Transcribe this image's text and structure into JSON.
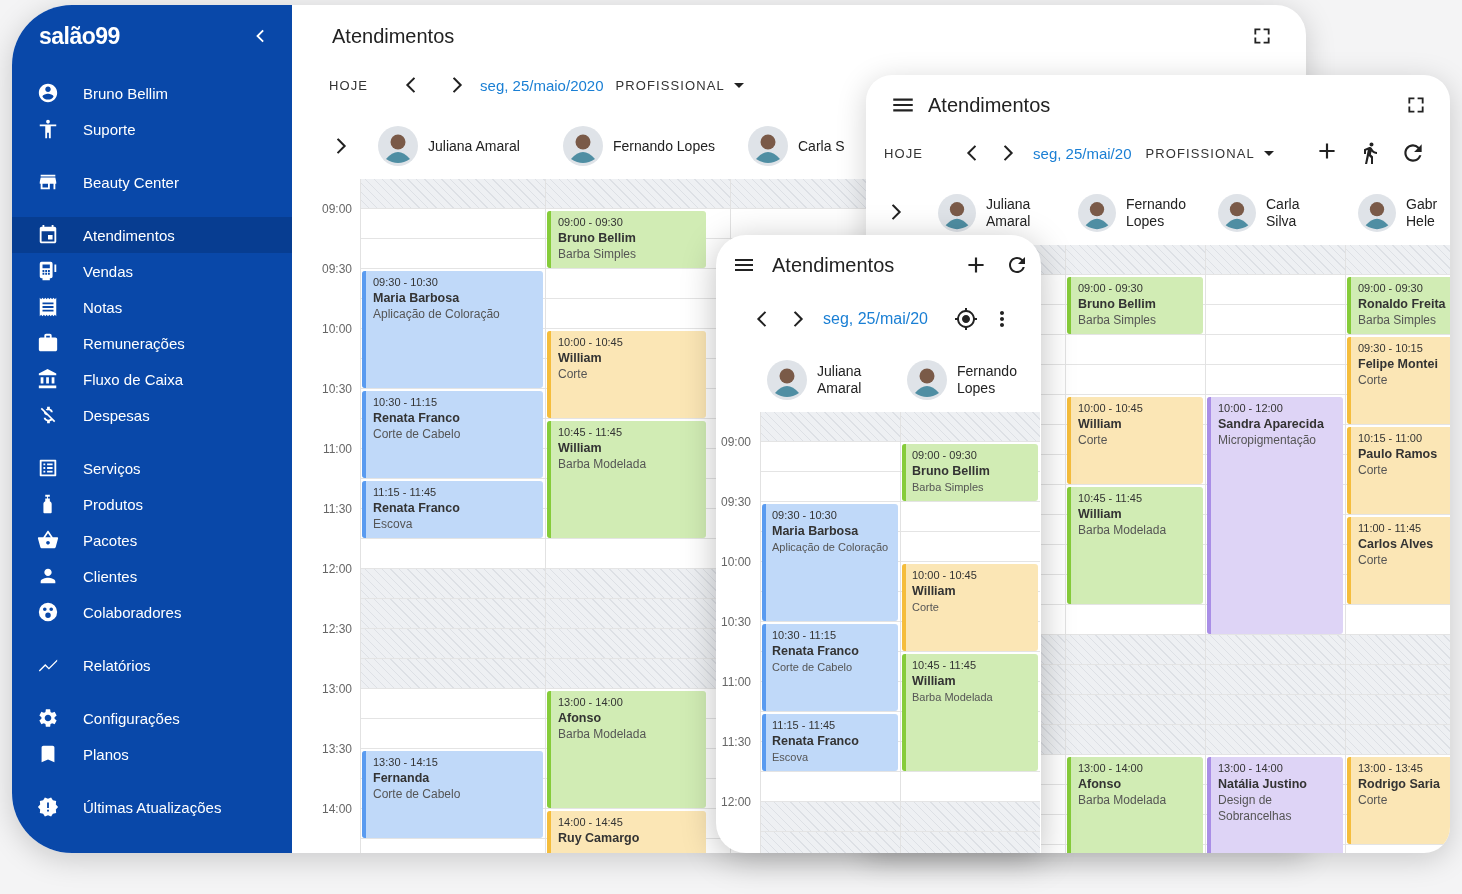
{
  "desktop": {
    "sidebar": {
      "logo": "salão99",
      "groups": [
        {
          "items": [
            {
              "label": "Bruno Bellim",
              "selected": false
            },
            {
              "label": "Suporte",
              "selected": false
            }
          ]
        },
        {
          "items": [
            {
              "label": "Beauty Center",
              "selected": false
            }
          ]
        },
        {
          "items": [
            {
              "label": "Atendimentos",
              "selected": true
            },
            {
              "label": "Vendas",
              "selected": false
            },
            {
              "label": "Notas",
              "selected": false
            },
            {
              "label": "Remunerações",
              "selected": false
            },
            {
              "label": "Fluxo de Caixa",
              "selected": false
            },
            {
              "label": "Despesas",
              "selected": false
            }
          ]
        },
        {
          "items": [
            {
              "label": "Serviços",
              "selected": false
            },
            {
              "label": "Produtos",
              "selected": false
            },
            {
              "label": "Pacotes",
              "selected": false
            },
            {
              "label": "Clientes",
              "selected": false
            },
            {
              "label": "Colaboradores",
              "selected": false
            }
          ]
        },
        {
          "items": [
            {
              "label": "Relatórios",
              "selected": false
            }
          ]
        },
        {
          "items": [
            {
              "label": "Configurações",
              "selected": false
            },
            {
              "label": "Planos",
              "selected": false
            }
          ]
        },
        {
          "items": [
            {
              "label": "Últimas Atualizações",
              "selected": false
            }
          ]
        }
      ]
    },
    "title": "Atendimentos",
    "toolbar": {
      "today": "HOJE",
      "date": "seg, 25/maio/2020",
      "filter": "PROFISSIONAL"
    },
    "professionals": [
      {
        "name": "Juliana Amaral"
      },
      {
        "name": "Fernando Lopes"
      },
      {
        "name": "Carla S"
      }
    ],
    "calendar": {
      "top_closed": true,
      "slots": [
        {
          "time": "09:00",
          "closed": false
        },
        {
          "time": "09:30",
          "closed": false
        },
        {
          "time": "10:00",
          "closed": false
        },
        {
          "time": "10:30",
          "closed": false
        },
        {
          "time": "11:00",
          "closed": false
        },
        {
          "time": "11:30",
          "closed": false
        },
        {
          "time": "12:00",
          "closed": true
        },
        {
          "time": "12:30",
          "closed": true
        },
        {
          "time": "13:00",
          "closed": false
        },
        {
          "time": "13:30",
          "closed": false
        },
        {
          "time": "14:00",
          "closed": false
        }
      ],
      "columns": [
        {
          "events": [
            {
              "time": "09:30 - 10:30",
              "client": "Maria Barbosa",
              "service": "Aplicação de Coloração",
              "color": "#5a9bf0"
            },
            {
              "time": "10:30 - 11:15",
              "client": "Renata Franco",
              "service": "Corte de Cabelo",
              "color": "#5a9bf0"
            },
            {
              "time": "11:15 - 11:45",
              "client": "Renata Franco",
              "service": "Escova",
              "color": "#5a9bf0"
            },
            {
              "time": "13:30 - 14:15",
              "client": "Fernanda",
              "service": "Corte de Cabelo",
              "color": "#5a9bf0"
            }
          ]
        },
        {
          "events": [
            {
              "time": "09:00 - 09:30",
              "client": "Bruno Bellim",
              "service": "Barba Simples",
              "color": "#86cc3a"
            },
            {
              "time": "10:00 - 10:45",
              "client": "William",
              "service": "Corte",
              "color": "#f5bd3c"
            },
            {
              "time": "10:45 - 11:45",
              "client": "William",
              "service": "Barba Modelada",
              "color": "#86cc3a"
            },
            {
              "time": "13:00 - 14:00",
              "client": "Afonso",
              "service": "Barba Modelada",
              "color": "#86cc3a"
            },
            {
              "time": "14:00 - 14:45",
              "client": "Ruy Camargo",
              "color": "#f5bd3c"
            }
          ]
        },
        {}
      ]
    }
  },
  "tablet": {
    "title": "Atendimentos",
    "toolbar": {
      "today": "HOJE",
      "date": "seg, 25/mai/20",
      "filter": "PROFISSIONAL"
    },
    "professionals": [
      {
        "name": "Juliana Amaral"
      },
      {
        "name": "Fernando Lopes"
      },
      {
        "name": "Carla Silva"
      },
      {
        "name": "Gabr Hele"
      }
    ],
    "calendar": {
      "top_closed": true,
      "slots": [
        {
          "closed": false
        },
        {
          "closed": false
        },
        {
          "closed": false
        },
        {
          "closed": false
        },
        {
          "closed": false
        },
        {
          "closed": false
        },
        {
          "closed": true
        },
        {
          "closed": true
        },
        {
          "closed": false
        },
        {
          "closed": false
        }
      ],
      "columns": [
        {},
        {
          "events": [
            {
              "time": "09:00 - 09:30",
              "client": "Bruno Bellim",
              "service": "Barba Simples",
              "color": "#86cc3a"
            },
            {
              "time": "10:00 - 10:45",
              "client": "William",
              "service": "Corte",
              "color": "#f5bd3c"
            },
            {
              "time": "10:45 - 11:45",
              "client": "William",
              "service": "Barba Modelada",
              "color": "#86cc3a"
            },
            {
              "time": "13:00 - 14:00",
              "client": "Afonso",
              "service": "Barba Modelada",
              "color": "#86cc3a"
            }
          ]
        },
        {
          "events": [
            {
              "time": "10:00 - 12:00",
              "client": "Sandra Aparecida",
              "service": "Micropigmentação",
              "color": "#a98ee6"
            },
            {
              "time": "13:00 - 14:00",
              "client": "Natália Justino",
              "service": "Design de Sobrancelhas",
              "color": "#a98ee6"
            }
          ]
        },
        {
          "events": [
            {
              "time": "09:00 - 09:30",
              "client": "Ronaldo Freita",
              "service": "Barba Simples",
              "color": "#86cc3a"
            },
            {
              "time": "09:30 - 10:15",
              "client": "Felipe Montei",
              "service": "Corte",
              "color": "#f5bd3c"
            },
            {
              "time": "10:15 - 11:00",
              "client": "Paulo Ramos",
              "service": "Corte",
              "color": "#f5bd3c"
            },
            {
              "time": "11:00 - 11:45",
              "client": "Carlos Alves",
              "service": "Corte",
              "color": "#f5bd3c"
            },
            {
              "time": "13:00 - 13:45",
              "client": "Rodrigo Saria",
              "service": "Corte",
              "color": "#f5bd3c"
            }
          ]
        }
      ]
    }
  },
  "phone": {
    "title": "Atendimentos",
    "toolbar": {
      "date": "seg, 25/mai/20"
    },
    "professionals": [
      {
        "name": "Juliana Amaral"
      },
      {
        "name": "Fernando Lopes"
      }
    ],
    "calendar": {
      "top_closed": true,
      "slots": [
        {
          "time": "09:00",
          "closed": false
        },
        {
          "time": "09:30",
          "closed": false
        },
        {
          "time": "10:00",
          "closed": false
        },
        {
          "time": "10:30",
          "closed": false
        },
        {
          "time": "11:00",
          "closed": false
        },
        {
          "time": "11:30",
          "closed": false
        },
        {
          "time": "12:00",
          "closed": true
        }
      ],
      "columns": [
        {
          "events": [
            {
              "time": "09:30 - 10:30",
              "client": "Maria Barbosa",
              "service": "Aplicação de Coloração",
              "color": "#5a9bf0"
            },
            {
              "time": "10:30 - 11:15",
              "client": "Renata Franco",
              "service": "Corte de Cabelo",
              "color": "#5a9bf0"
            },
            {
              "time": "11:15 - 11:45",
              "client": "Renata Franco",
              "service": "Escova",
              "color": "#5a9bf0"
            }
          ]
        },
        {
          "events": [
            {
              "time": "09:00 - 09:30",
              "client": "Bruno Bellim",
              "service": "Barba Simples",
              "color": "#86cc3a"
            },
            {
              "time": "10:00 - 10:45",
              "client": "William",
              "service": "Corte",
              "color": "#f5bd3c"
            },
            {
              "time": "10:45 - 11:45",
              "client": "William",
              "service": "Barba Modelada",
              "color": "#86cc3a"
            }
          ]
        }
      ]
    }
  }
}
